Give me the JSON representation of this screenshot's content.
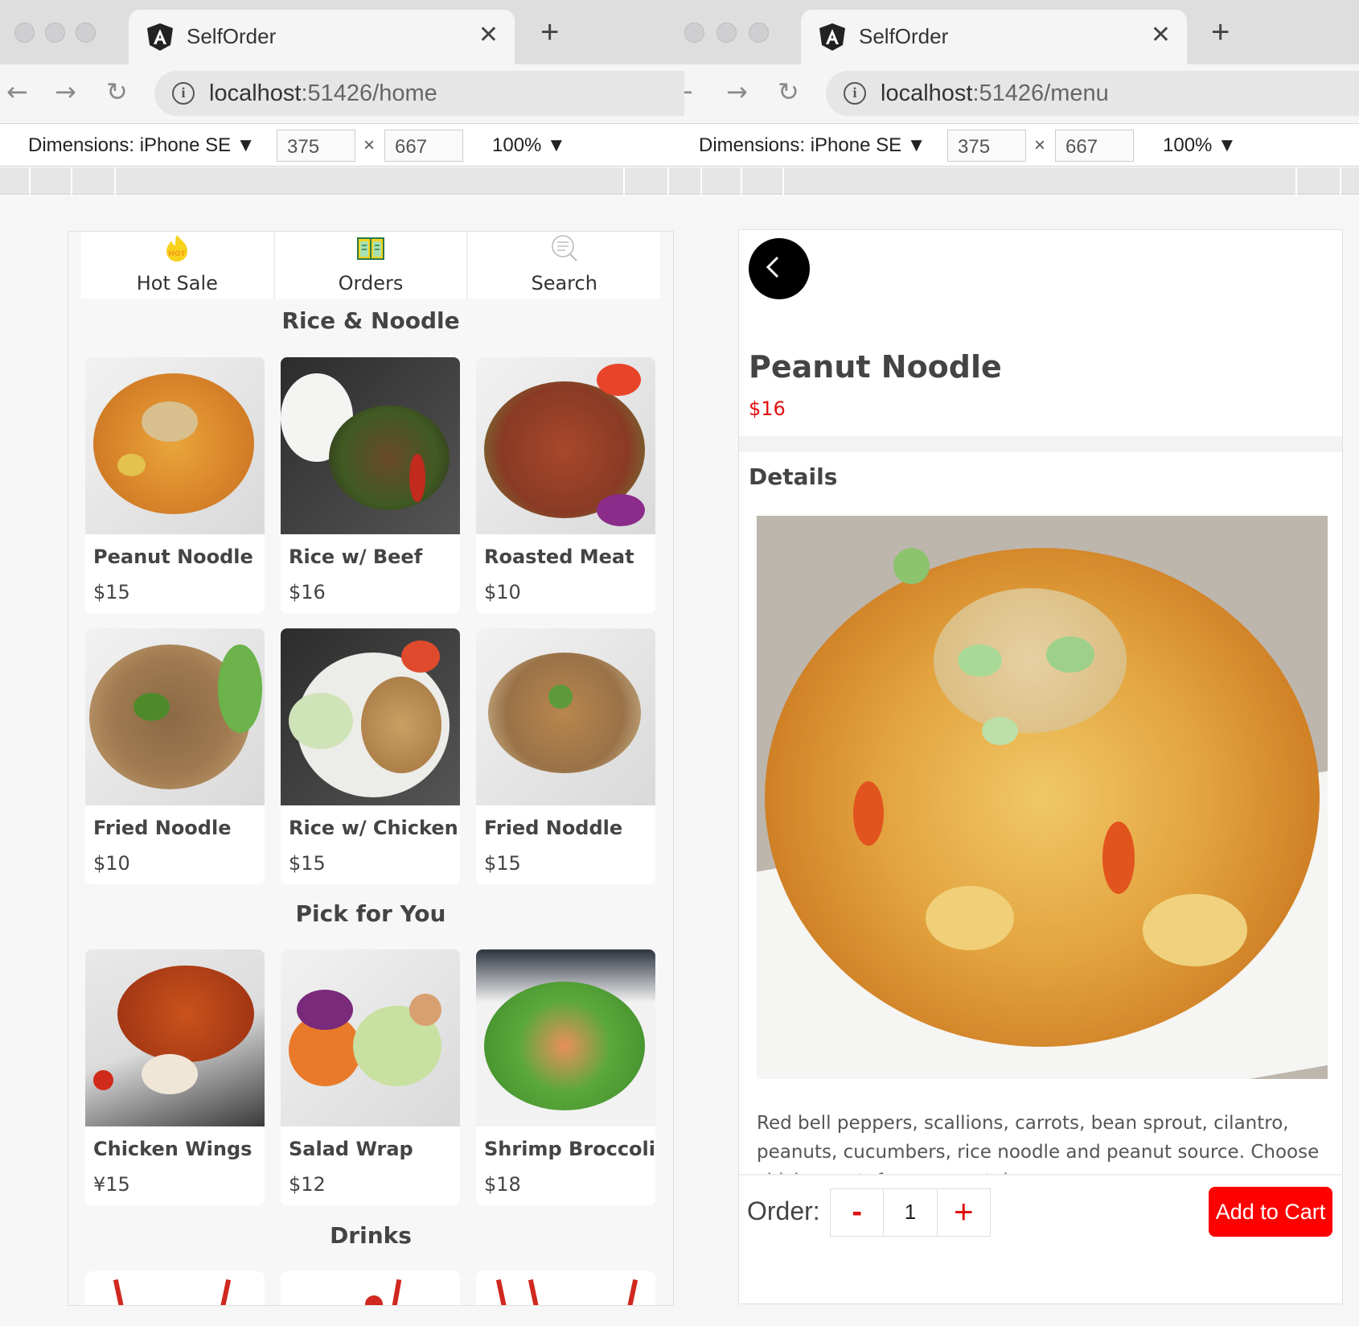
{
  "left_window": {
    "tab_title": "SelfOrder",
    "url_host": "localhost",
    "url_path": ":51426/home",
    "device": "Dimensions: iPhone SE ▼",
    "width": "375",
    "height": "667",
    "times": "×",
    "zoom": "100% ▼"
  },
  "right_window": {
    "tab_title": "SelfOrder",
    "url_host": "localhost",
    "url_path": ":51426/menu",
    "device": "Dimensions: iPhone SE ▼",
    "width": "375",
    "height": "667",
    "times": "×",
    "zoom": "100% ▼"
  },
  "icons": {
    "close": "✕",
    "new_tab": "+",
    "back": "←",
    "forward": "→",
    "reload": "↻",
    "info": "i"
  },
  "home": {
    "nav": [
      {
        "label": "Hot Sale",
        "icon": "hot-flame-icon"
      },
      {
        "label": "Orders",
        "icon": "menu-book-icon"
      },
      {
        "label": "Search",
        "icon": "search-icon"
      }
    ],
    "hot_badge": "HOT",
    "sections": [
      {
        "title": "Rice & Noodle",
        "items": [
          {
            "name": "Peanut Noodle",
            "price": "$15"
          },
          {
            "name": "Rice w/ Beef",
            "price": "$16"
          },
          {
            "name": "Roasted Meat",
            "price": "$10"
          },
          {
            "name": "Fried Noodle",
            "price": "$10"
          },
          {
            "name": "Rice w/ Chicken",
            "price": "$15"
          },
          {
            "name": "Fried Noddle",
            "price": "$15"
          }
        ]
      },
      {
        "title": "Pick for You",
        "items": [
          {
            "name": "Chicken Wings",
            "price": "¥15"
          },
          {
            "name": "Salad Wrap",
            "price": "$12"
          },
          {
            "name": "Shrimp Broccoli",
            "price": "$18"
          }
        ]
      },
      {
        "title": "Drinks",
        "items": []
      }
    ]
  },
  "detail": {
    "name": "Peanut Noodle",
    "price": "$16",
    "details_label": "Details",
    "description": "Red bell peppers, scallions, carrots, bean sprout, cilantro, peanuts, cucumbers, rice noodle and peanut source. Choose chicken or tofu or no protein.",
    "order_label": "Order:",
    "minus": "-",
    "quantity": "1",
    "plus": "+",
    "add_to_cart": "Add to Cart"
  },
  "colors": {
    "price_red": "#e01010",
    "cart_button": "#ff0000",
    "hot_yellow": "#f7d21c"
  }
}
